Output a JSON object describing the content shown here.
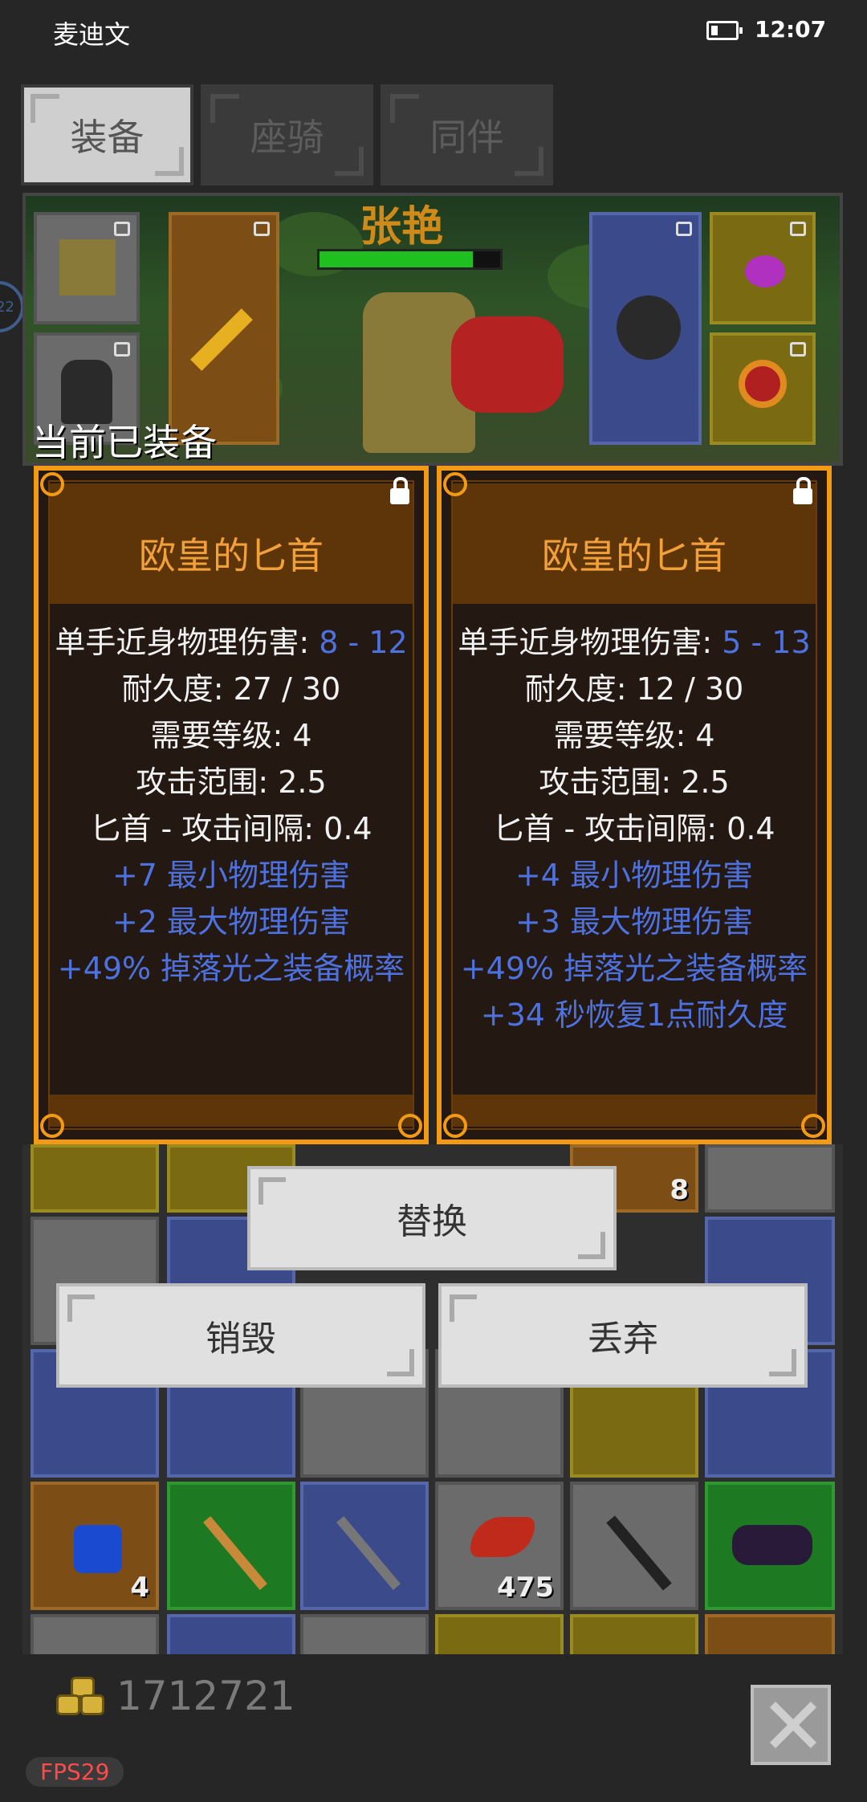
{
  "status_bar": {
    "carrier": "麦迪文",
    "time": "12:07"
  },
  "tabs": [
    {
      "label": "装备",
      "active": true
    },
    {
      "label": "座骑",
      "active": false
    },
    {
      "label": "同伴",
      "active": false
    }
  ],
  "side_badge": "22",
  "character": {
    "name": "张艳",
    "hp_fraction": 0.85
  },
  "equipped_label": "当前已装备",
  "cards": [
    {
      "title": "欧皇的匕首",
      "stats_white": [
        {
          "label": "单手近身物理伤害: ",
          "value": "8 - 12"
        },
        {
          "label": "耐久度: 27 / 30"
        },
        {
          "label": "需要等级: 4"
        },
        {
          "label": "攻击范围: 2.5"
        },
        {
          "label": "匕首 - 攻击间隔: 0.4"
        }
      ],
      "stats_blue": [
        "+7 最小物理伤害",
        "+2 最大物理伤害",
        "+49% 掉落光之装备概率"
      ]
    },
    {
      "title": "欧皇的匕首",
      "stats_white": [
        {
          "label": "单手近身物理伤害: ",
          "value": "5 - 13"
        },
        {
          "label": "耐久度: 12 / 30"
        },
        {
          "label": "需要等级: 4"
        },
        {
          "label": "攻击范围: 2.5"
        },
        {
          "label": "匕首 - 攻击间隔: 0.4"
        }
      ],
      "stats_blue": [
        "+4 最小物理伤害",
        "+3 最大物理伤害",
        "+49% 掉落光之装备概率",
        "+34 秒恢复1点耐久度"
      ]
    }
  ],
  "buttons": {
    "replace": "替换",
    "destroy": "销毁",
    "discard": "丢弃"
  },
  "inventory_quantities": {
    "q1": "8",
    "q2": "4",
    "q3": "475"
  },
  "footer": {
    "gold": "1712721",
    "fps": "FPS29"
  },
  "colors": {
    "accent_orange": "#f29a13",
    "stat_blue": "#4d72e0",
    "title_orange": "#f2a03a"
  }
}
